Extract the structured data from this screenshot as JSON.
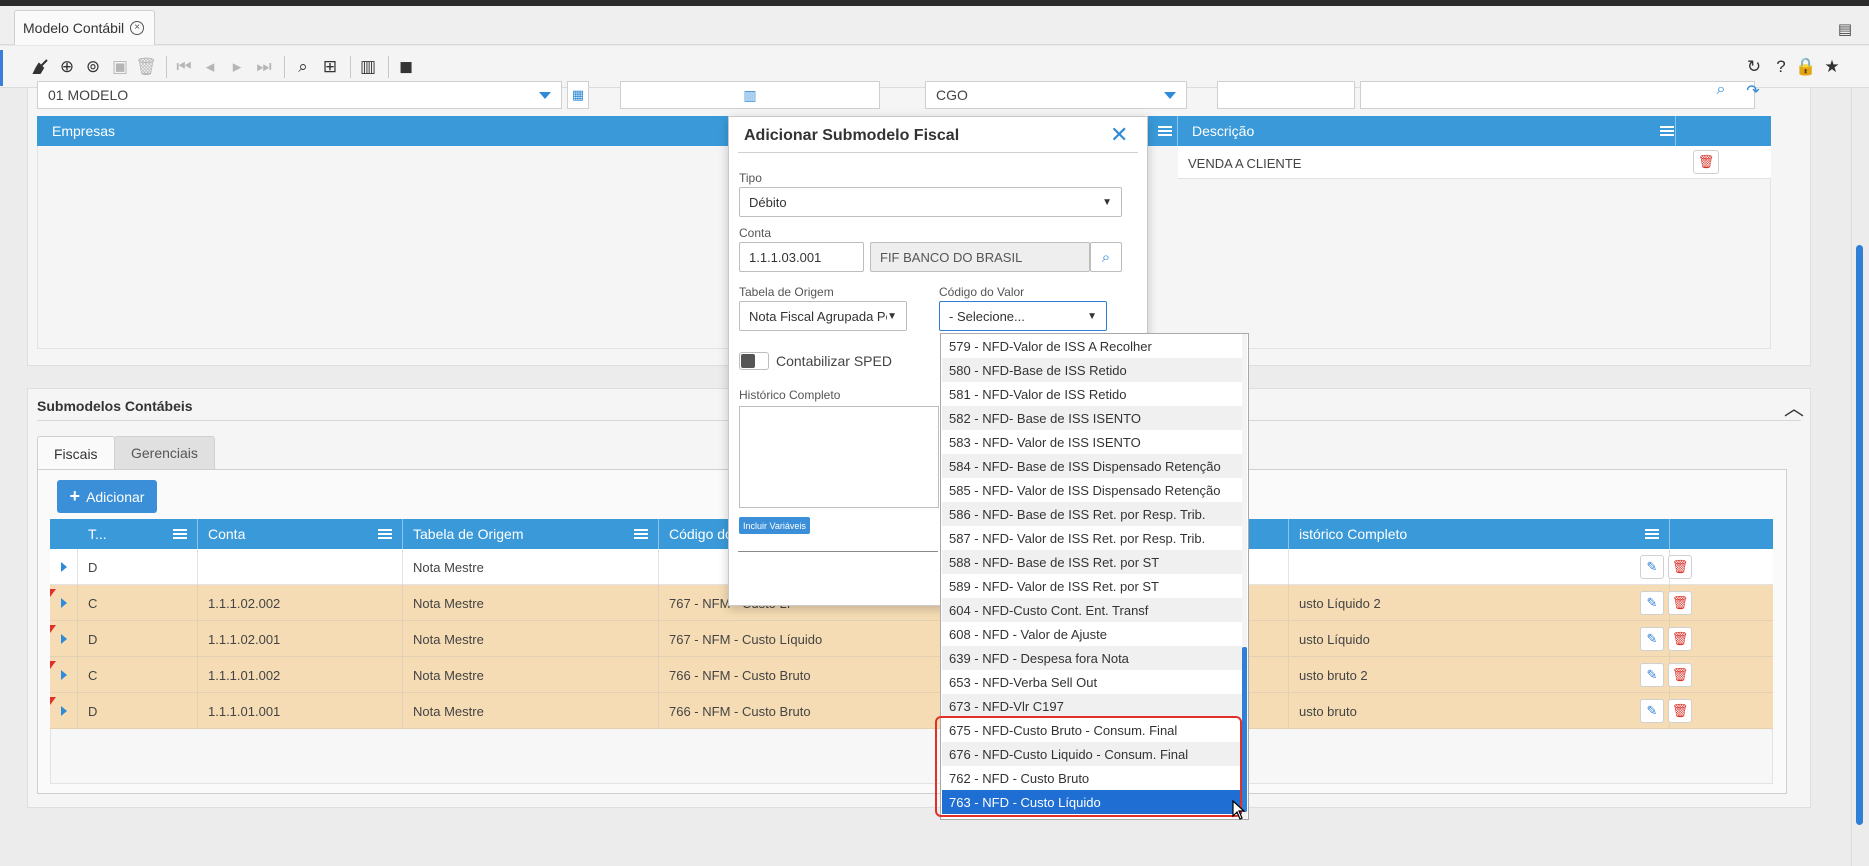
{
  "window": {
    "tab_title": "Modelo Contábil",
    "close_glyph": "×"
  },
  "toolbar": {
    "icons": [
      "broom-icon",
      "plus-circle-icon",
      "copy-icon",
      "save-icon",
      "trash-icon",
      "first-icon",
      "prev-icon",
      "next-icon",
      "last-icon",
      "search-icon",
      "grid-icon",
      "report-icon",
      "layers-icon",
      "refresh-icon",
      "help-icon",
      "lock-icon",
      "star-icon"
    ]
  },
  "header_form": {
    "modelo_value": "01 MODELO",
    "cgo_value": "CGO"
  },
  "empresas_grid": {
    "col_empresas": "Empresas",
    "col_descricao": "Descrição",
    "row_descricao": "VENDA A CLIENTE"
  },
  "submodelos": {
    "title": "Submodelos Contábeis",
    "tab_fiscais": "Fiscais",
    "tab_gerenciais": "Gerenciais",
    "add_label": "Adicionar",
    "columns": [
      "T...",
      "Conta",
      "Tabela de Origem",
      "Código do Valor",
      "istórico Completo"
    ],
    "rows": [
      {
        "tipo": "D",
        "conta": "",
        "tabela": "Nota Mestre",
        "codigo": "",
        "historico": "",
        "style": "white"
      },
      {
        "tipo": "C",
        "conta": "1.1.1.02.002",
        "tabela": "Nota Mestre",
        "codigo": "767 - NFM - Custo Lí",
        "historico": "usto Líquido 2",
        "style": "tan"
      },
      {
        "tipo": "D",
        "conta": "1.1.1.02.001",
        "tabela": "Nota Mestre",
        "codigo": "767 - NFM - Custo Líquido",
        "historico": "usto Líquido",
        "style": "tan"
      },
      {
        "tipo": "C",
        "conta": "1.1.1.01.002",
        "tabela": "Nota Mestre",
        "codigo": "766 - NFM - Custo Bruto",
        "historico": "usto bruto 2",
        "style": "tan"
      },
      {
        "tipo": "D",
        "conta": "1.1.1.01.001",
        "tabela": "Nota Mestre",
        "codigo": "766 - NFM - Custo Bruto",
        "historico": "usto bruto",
        "style": "tan"
      }
    ]
  },
  "modal": {
    "title": "Adicionar Submodelo Fiscal",
    "tipo_label": "Tipo",
    "tipo_value": "Débito",
    "conta_label": "Conta",
    "conta_value": "1.1.1.03.001",
    "conta_desc": "FIF BANCO DO BRASIL",
    "tabela_label": "Tabela de Origem",
    "tabela_value": "Nota Fiscal Agrupada Po",
    "codigo_label": "Código do Valor",
    "codigo_value": "- Selecione...",
    "sped_label": "Contabilizar SPED",
    "historico_label": "Histórico Completo",
    "vars_label": "Incluir Variáveis"
  },
  "dropdown": {
    "options": [
      "579 - NFD-Valor de ISS A Recolher",
      "580 - NFD-Base de ISS Retido",
      "581 - NFD-Valor de ISS Retido",
      "582 - NFD- Base de ISS ISENTO",
      "583 - NFD- Valor de ISS ISENTO",
      "584 - NFD- Base de ISS Dispensado Retenção",
      "585 - NFD- Valor de ISS Dispensado Retenção",
      "586 - NFD- Base de ISS Ret. por Resp. Trib.",
      "587 - NFD- Valor de ISS Ret. por Resp. Trib.",
      "588 - NFD- Base de ISS Ret. por ST",
      "589 - NFD- Valor de ISS Ret. por ST",
      "604 - NFD-Custo Cont. Ent. Transf",
      "608 - NFD - Valor de Ajuste",
      "639 - NFD - Despesa fora Nota",
      "653 - NFD-Verba Sell Out",
      "673 - NFD-Vlr C197",
      "675 - NFD-Custo Bruto - Consum. Final",
      "676 - NFD-Custo Liquido - Consum. Final",
      "762 - NFD - Custo Bruto",
      "763 - NFD - Custo Líquido"
    ],
    "selected_index": 19
  }
}
